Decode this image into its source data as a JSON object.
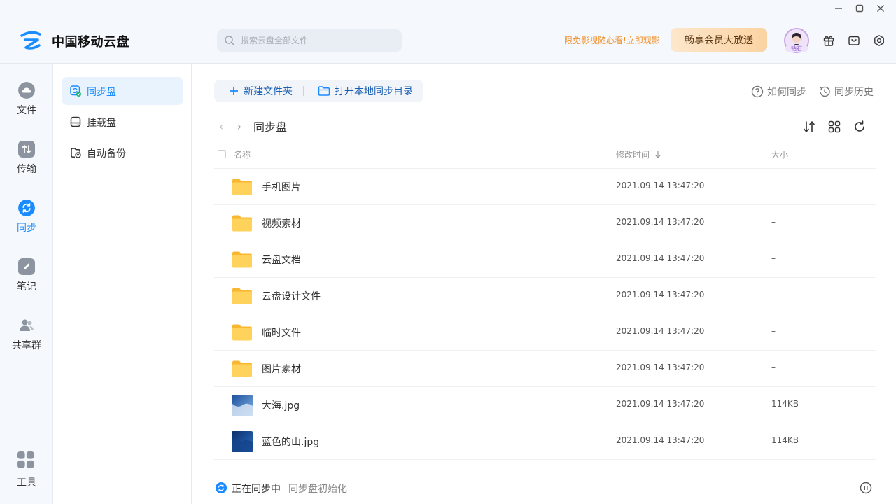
{
  "app": {
    "name": "中国移动云盘"
  },
  "search": {
    "placeholder": "搜索云盘全部文件"
  },
  "header": {
    "promo": "限免影视随心看!立即观影",
    "vip_button": "畅享会员大放送",
    "avatar_badge": "钻石"
  },
  "left_nav": [
    {
      "label": "文件",
      "icon": "cloud-icon"
    },
    {
      "label": "传输",
      "icon": "transfer-icon"
    },
    {
      "label": "同步",
      "icon": "sync-icon",
      "active": true
    },
    {
      "label": "笔记",
      "icon": "note-icon"
    },
    {
      "label": "共享群",
      "icon": "group-icon"
    },
    {
      "label": "工具",
      "icon": "tools-icon"
    }
  ],
  "sub_nav": [
    {
      "label": "同步盘",
      "active": true
    },
    {
      "label": "挂载盘"
    },
    {
      "label": "自动备份"
    }
  ],
  "toolbar": {
    "new_folder": "新建文件夹",
    "open_local": "打开本地同步目录"
  },
  "help": {
    "how_to_sync": "如何同步",
    "sync_history": "同步历史"
  },
  "breadcrumb": {
    "title": "同步盘"
  },
  "table": {
    "headers": {
      "name": "名称",
      "modified": "修改时间",
      "size": "大小"
    },
    "rows": [
      {
        "name": "手机图片",
        "modified": "2021.09.14 13:47:20",
        "size": "–",
        "type": "folder"
      },
      {
        "name": "视频素材",
        "modified": "2021.09.14 13:47:20",
        "size": "–",
        "type": "folder"
      },
      {
        "name": "云盘文档",
        "modified": "2021.09.14 13:47:20",
        "size": "–",
        "type": "folder"
      },
      {
        "name": "云盘设计文件",
        "modified": "2021.09.14 13:47:20",
        "size": "–",
        "type": "folder"
      },
      {
        "name": "临时文件",
        "modified": "2021.09.14 13:47:20",
        "size": "–",
        "type": "folder"
      },
      {
        "name": "图片素材",
        "modified": "2021.09.14 13:47:20",
        "size": "–",
        "type": "folder"
      },
      {
        "name": "大海.jpg",
        "modified": "2021.09.14 13:47:20",
        "size": "114KB",
        "type": "image"
      },
      {
        "name": "蓝色的山.jpg",
        "modified": "2021.09.14 13:47:20",
        "size": "114KB",
        "type": "image"
      }
    ]
  },
  "footer": {
    "status": "正在同步中",
    "detail": "同步盘初始化"
  },
  "colors": {
    "accent": "#1a8cff",
    "folder": "#ffd25c",
    "promo": "#f0902b",
    "nav_icon": "#8c959f"
  }
}
